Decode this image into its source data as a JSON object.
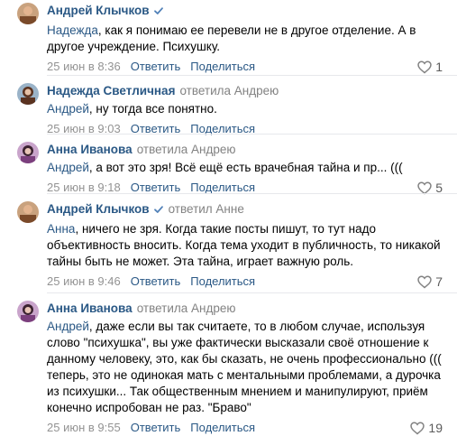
{
  "comments": [
    {
      "author": "Андрей Клычков",
      "verified": true,
      "reply_to": "",
      "mention": "Надежда",
      "text": ", как я понимаю ее перевели не в другое отделение. А в другое учреждение. Психушку.",
      "date": "25 июн в 8:36",
      "reply_label": "Ответить",
      "share_label": "Поделиться",
      "likes": "1",
      "avatar_color": "#b07a4a"
    },
    {
      "author": "Надежда Светличная",
      "verified": false,
      "reply_to": "ответила Андрею",
      "mention": "Андрей",
      "text": ", ну тогда все понятно.",
      "date": "25 июн в 9:03",
      "reply_label": "Ответить",
      "share_label": "Поделиться",
      "likes": "",
      "avatar_color": "#6b3f2a"
    },
    {
      "author": "Анна Иванова",
      "verified": false,
      "reply_to": "ответила Андрею",
      "mention": "Андрей",
      "text": ", а вот это зря! Всё ещё есть врачебная тайна и пр... (((",
      "date": "25 июн в 9:18",
      "reply_label": "Ответить",
      "share_label": "Поделиться",
      "likes": "5",
      "avatar_color": "#8a4d8c"
    },
    {
      "author": "Андрей Клычков",
      "verified": true,
      "reply_to": "ответил Анне",
      "mention": "Анна",
      "text": ", ничего не зря. Когда такие посты пишут, то тут надо объективность вносить. Когда тема уходит в публичность, то никакой тайны быть не может. Эта тайна, играет важную роль.",
      "date": "25 июн в 9:46",
      "reply_label": "Ответить",
      "share_label": "Поделиться",
      "likes": "7",
      "avatar_color": "#b07a4a"
    },
    {
      "author": "Анна Иванова",
      "verified": false,
      "reply_to": "ответила Андрею",
      "mention": "Андрей",
      "text": ", даже если вы так считаете, то в любом случае, используя слово \"психушка\", вы уже фактически высказали своё отношение к данному человеку, это, как бы сказать, не очень профессионально ((( теперь, это не одинокая мать с ментальными проблемами, а дурочка из психушки... Так общественным мнением и манипулируют, приём конечно испробован не раз. \"Браво\"",
      "date": "25 июн в 9:55",
      "reply_label": "Ответить",
      "share_label": "Поделиться",
      "likes": "19",
      "avatar_color": "#8a4d8c"
    }
  ]
}
